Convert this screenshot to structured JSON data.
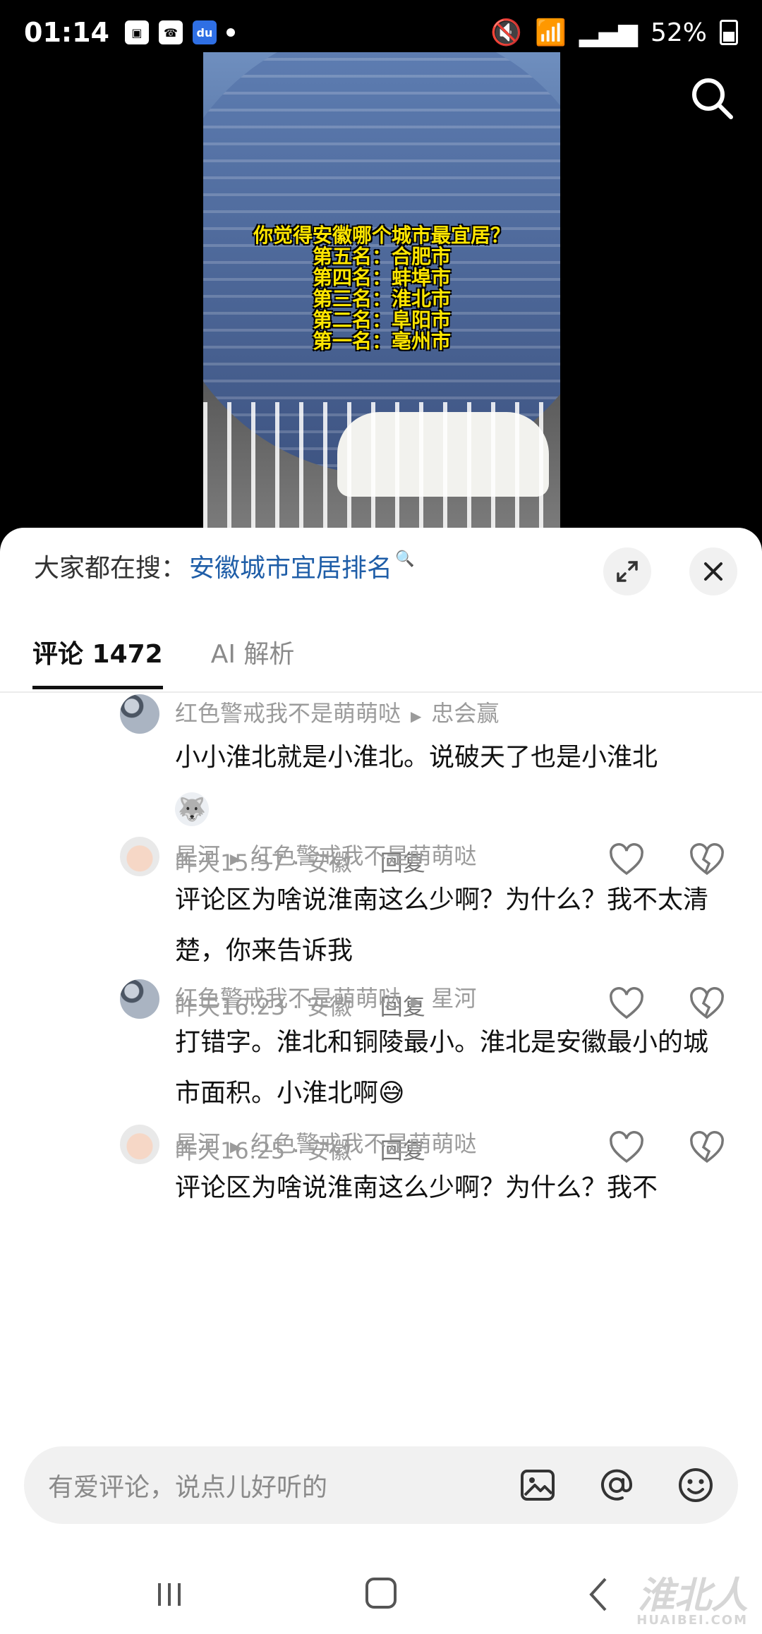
{
  "status_bar": {
    "time": "01:14",
    "battery": "52%",
    "icons": [
      "image-icon",
      "app-icon",
      "baidu-icon",
      "mute-icon",
      "wifi-icon",
      "signal-icon",
      "battery-icon"
    ]
  },
  "video": {
    "caption_lines": [
      "你觉得安徽哪个城市最宜居？",
      "第五名：合肥市",
      "第四名：蚌埠市",
      "第三名：淮北市",
      "第二名：阜阳市",
      "第一名：亳州市"
    ]
  },
  "sheet": {
    "hot_search_label": "大家都在搜：",
    "hot_search_keyword": "安徽城市宜居排名",
    "tabs": [
      "评论 1472",
      "AI 解析"
    ]
  },
  "comments": [
    {
      "author": "红色警戒我不是萌萌哒",
      "reply_to": "忠会赢",
      "text": "小小淮北就是小淮北。说破天了也是小淮北",
      "emoji": "🐺",
      "meta": "昨天15:57 · 安徽",
      "reply_label": "回复"
    },
    {
      "author": "星河",
      "reply_to": "红色警戒我不是萌萌哒",
      "text": "评论区为啥说淮南这么少啊？为什么？我不太清楚，你来告诉我",
      "meta": "昨天16:23 · 安徽",
      "reply_label": "回复"
    },
    {
      "author": "红色警戒我不是萌萌哒",
      "reply_to": "星河",
      "text": "打错字。淮北和铜陵最小。淮北是安徽最小的城市面积。小淮北啊😅",
      "meta": "昨天16:25 · 安徽",
      "reply_label": "回复"
    },
    {
      "author": "星河",
      "reply_to": "红色警戒我不是萌萌哒",
      "text": "评论区为啥说淮南这么少啊？为什么？我不"
    }
  ],
  "input": {
    "placeholder": "有爱评论，说点儿好听的"
  },
  "watermark": {
    "text": "淮北人",
    "domain": "HUAIBEI.COM"
  }
}
